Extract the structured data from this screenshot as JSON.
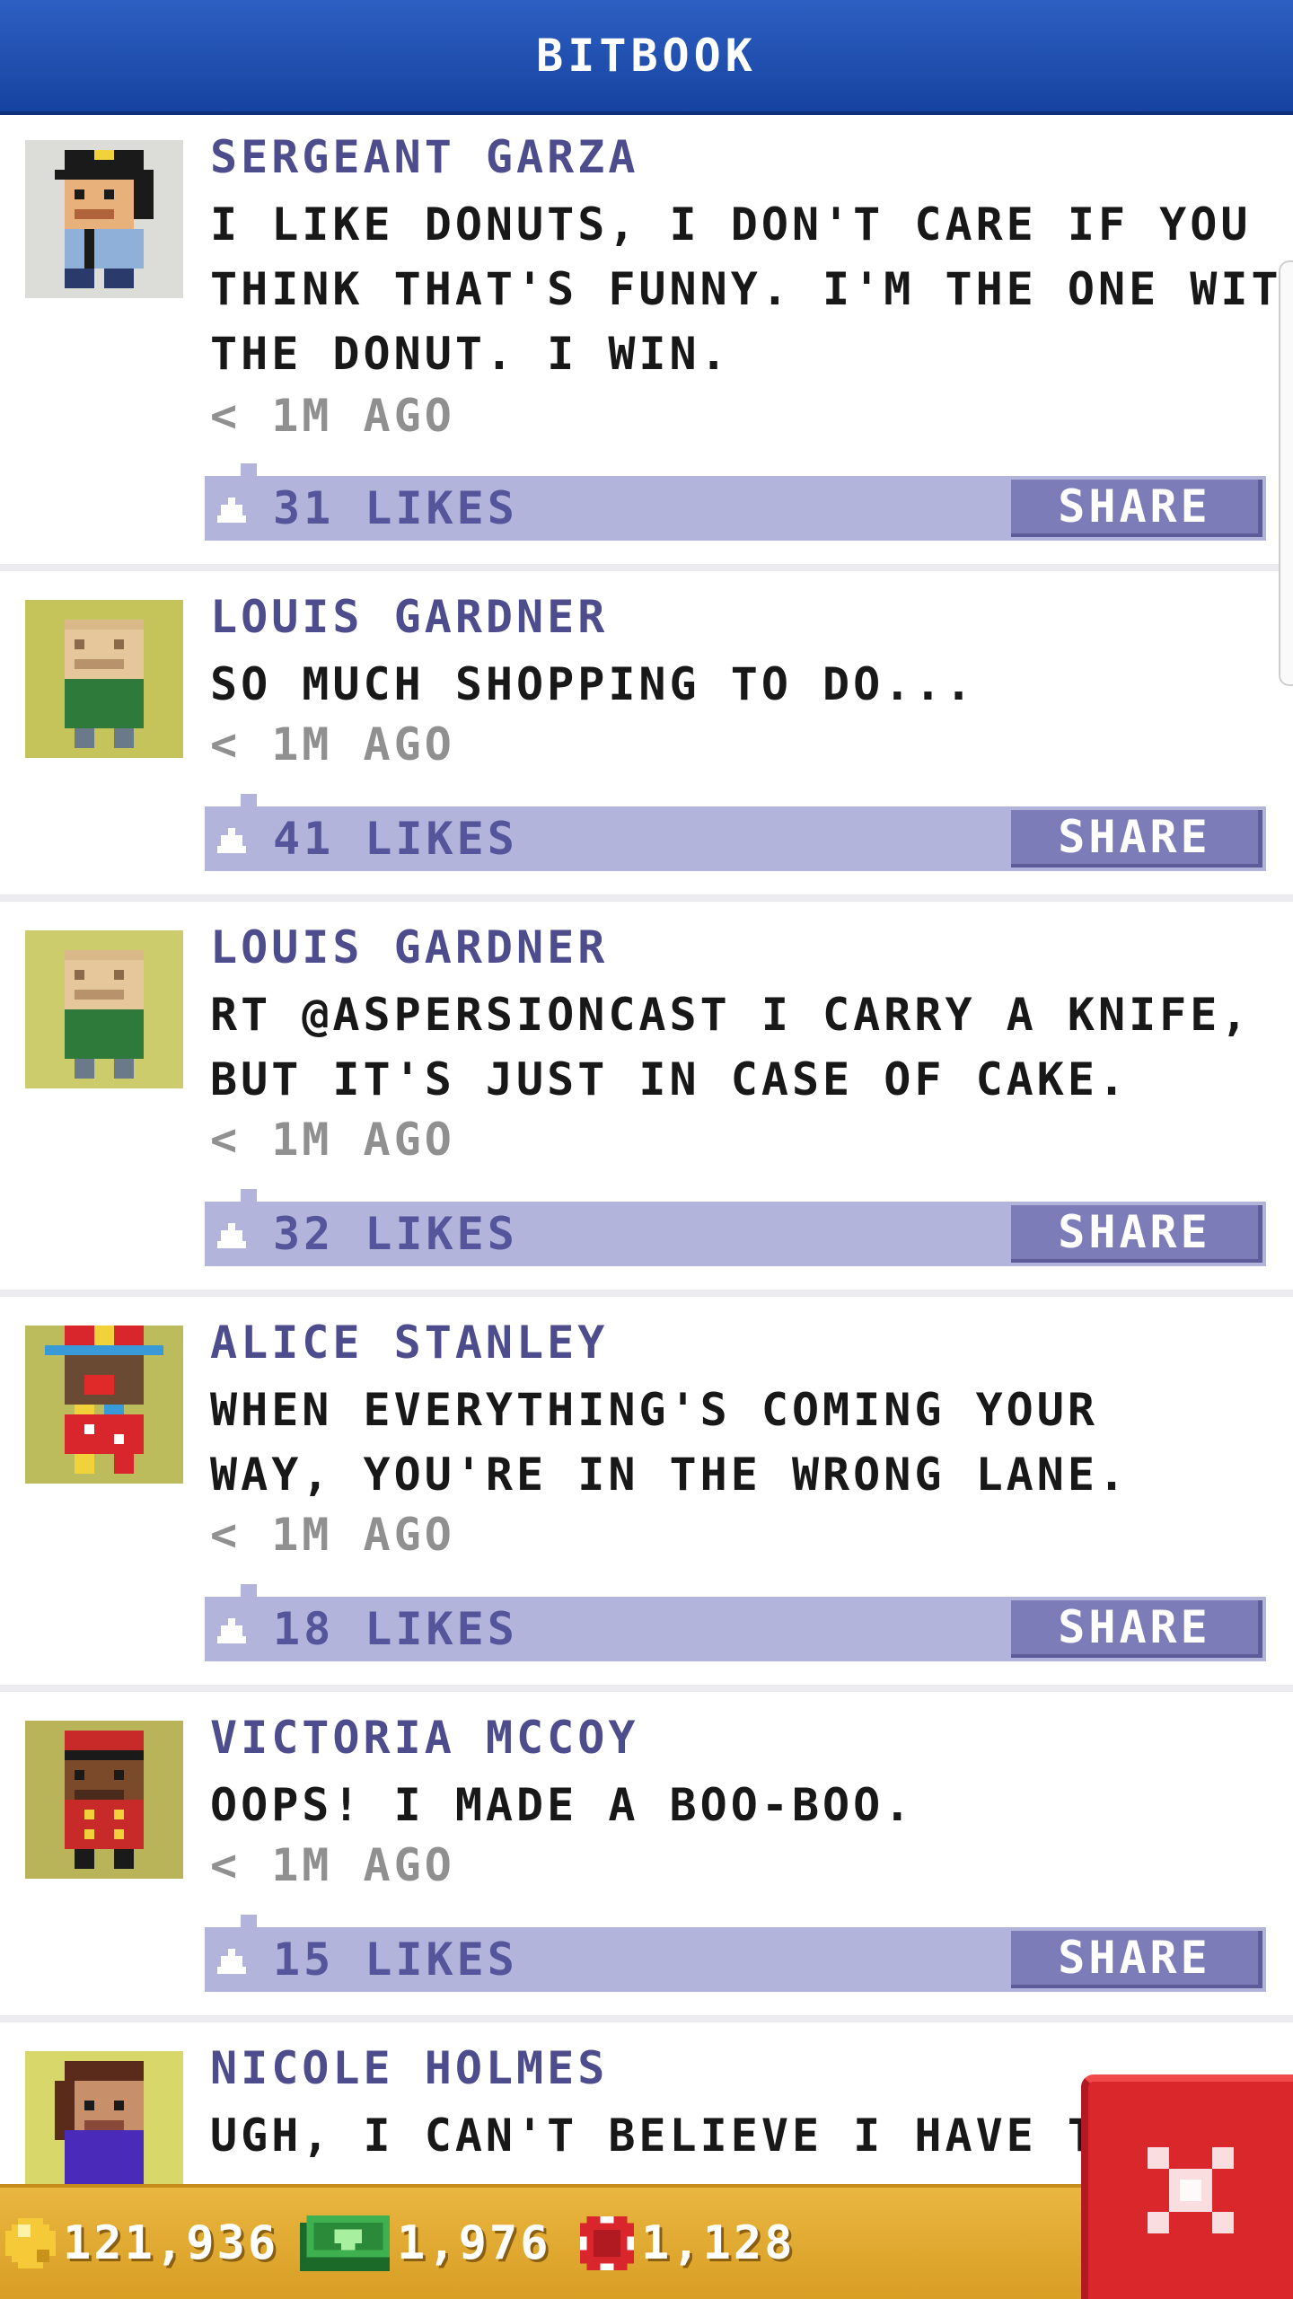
{
  "header": {
    "title": "BITBOOK"
  },
  "posts": [
    {
      "author": "SERGEANT GARZA",
      "message": "I LIKE DONUTS, I DON'T CARE IF YOU\nTHINK THAT'S FUNNY. I'M THE ONE WITH\nTHE DONUT. I WIN.",
      "time": "< 1M AGO",
      "likes": "31 LIKES",
      "share": "SHARE",
      "avatar": "police-officer-avatar"
    },
    {
      "author": "LOUIS GARDNER",
      "message": "SO MUCH SHOPPING TO DO...",
      "time": "< 1M AGO",
      "likes": "41 LIKES",
      "share": "SHARE",
      "avatar": "bald-man-avatar"
    },
    {
      "author": "LOUIS GARDNER",
      "message": "RT @ASPERSIONCAST I CARRY A KNIFE,\nBUT IT'S JUST IN CASE OF CAKE.",
      "time": "< 1M AGO",
      "likes": "32 LIKES",
      "share": "SHARE",
      "avatar": "bald-man-avatar"
    },
    {
      "author": "ALICE STANLEY",
      "message": "WHEN EVERYTHING'S COMING YOUR\nWAY, YOU'RE IN THE WRONG LANE.",
      "time": "< 1M AGO",
      "likes": "18 LIKES",
      "share": "SHARE",
      "avatar": "clown-avatar"
    },
    {
      "author": "VICTORIA MCCOY",
      "message": "OOPS! I MADE A BOO-BOO.",
      "time": "< 1M AGO",
      "likes": "15 LIKES",
      "share": "SHARE",
      "avatar": "bellhop-avatar"
    },
    {
      "author": "NICOLE HOLMES",
      "message": "UGH, I CAN'T BELIEVE I HAVE TO",
      "time": "",
      "likes": "",
      "share": "",
      "avatar": "woman-avatar"
    }
  ],
  "currencies": {
    "coins": "121,936",
    "bux": "1,976",
    "tickets": "1,128"
  },
  "close_button": {
    "icon": "close-icon"
  },
  "colors": {
    "header": "#1f4fb4",
    "author": "#4d4c8c",
    "likes_bar": "#b3b4db",
    "share_button": "#7c7db8",
    "bottom_bar": "#e2a92f",
    "close_button": "#d9272c"
  }
}
